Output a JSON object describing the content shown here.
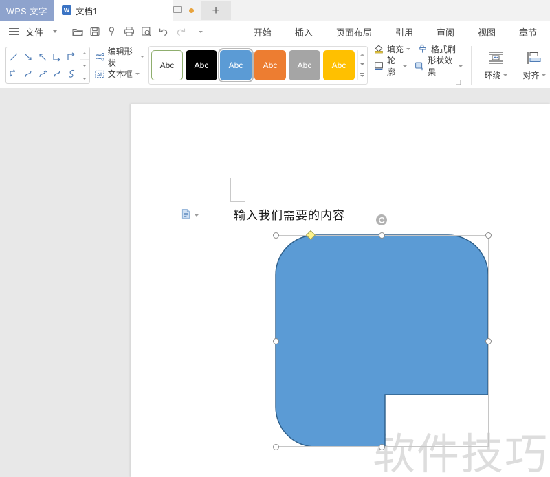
{
  "titlebar": {
    "brand": "WPS 文字",
    "tab": {
      "icon": "wps-writer-icon",
      "badge": "W",
      "title": "文档1"
    },
    "monitor_icon": "monitor-icon",
    "status_dot": "orange-status-dot",
    "new_tab_label": "+"
  },
  "quickaccess": {
    "menu_icon": "hamburger-menu-icon",
    "file_label": "文件",
    "file_chevron": "chevron-down-icon",
    "items": [
      {
        "name": "open-folder-icon",
        "label": "打开"
      },
      {
        "name": "save-icon",
        "label": "保存"
      },
      {
        "name": "touch-mode-icon",
        "label": "触摸"
      },
      {
        "name": "print-icon",
        "label": "打印"
      },
      {
        "name": "print-preview-icon",
        "label": "打印预览"
      },
      {
        "name": "undo-icon",
        "label": "撤销"
      },
      {
        "name": "redo-icon",
        "label": "恢复"
      }
    ],
    "more_chevron": "chevron-down-icon"
  },
  "ribbon_tabs": [
    {
      "label": "开始",
      "active": false
    },
    {
      "label": "插入",
      "active": false
    },
    {
      "label": "页面布局",
      "active": false
    },
    {
      "label": "引用",
      "active": false
    },
    {
      "label": "审阅",
      "active": false
    },
    {
      "label": "视图",
      "active": false
    },
    {
      "label": "章节",
      "active": false
    }
  ],
  "ribbon": {
    "shape_gallery": {
      "shapes": [
        "line-shape",
        "arrow-line-shape",
        "up-arrow-line-shape",
        "elbow-connector-shape",
        "elbow-arrow-connector-shape",
        "elbow-double-arrow-shape",
        "curved-connector-shape",
        "curved-arrow-connector-shape",
        "curved-double-arrow-shape",
        "freeform-curve-shape"
      ],
      "scroll_up": "scroll-up-icon",
      "scroll_down": "scroll-down-icon",
      "more": "gallery-more-icon"
    },
    "edit_shape": {
      "label": "编辑形状",
      "icon": "edit-shape-icon",
      "chevron": "chevron-down-icon"
    },
    "text_box": {
      "label": "文本框",
      "icon": "text-box-icon",
      "chevron": "chevron-down-icon"
    },
    "shape_styles": {
      "label": "Abc",
      "swatches": [
        {
          "name": "style-white-outline",
          "fill": "#ffffff",
          "border": "#8fae6e",
          "text": "#333333",
          "selected": false
        },
        {
          "name": "style-black",
          "fill": "#000000",
          "border": "#000000",
          "text": "#ffffff",
          "selected": false
        },
        {
          "name": "style-blue",
          "fill": "#5b9bd5",
          "border": "#5b9bd5",
          "text": "#ffffff",
          "selected": true
        },
        {
          "name": "style-orange",
          "fill": "#ed7d31",
          "border": "#ed7d31",
          "text": "#ffffff",
          "selected": false
        },
        {
          "name": "style-gray",
          "fill": "#a5a5a5",
          "border": "#a5a5a5",
          "text": "#ffffff",
          "selected": false
        },
        {
          "name": "style-yellow",
          "fill": "#ffc000",
          "border": "#ffc000",
          "text": "#ffffff",
          "selected": false
        }
      ],
      "scroll_up": "scroll-up-icon",
      "scroll_down": "scroll-down-icon",
      "more": "gallery-more-icon"
    },
    "fill": {
      "label": "填充",
      "icon": "fill-bucket-icon",
      "chevron": "chevron-down-icon"
    },
    "format_painter": {
      "label": "格式刷",
      "icon": "format-painter-icon"
    },
    "outline": {
      "label": "轮廓",
      "icon": "shape-outline-icon",
      "chevron": "chevron-down-icon"
    },
    "shape_effects": {
      "label": "形状效果",
      "icon": "shape-effects-icon",
      "chevron": "chevron-down-icon"
    },
    "wrap_text": {
      "label": "环绕",
      "icon": "wrap-text-icon",
      "chevron": "chevron-down-icon"
    },
    "align": {
      "label": "对齐",
      "icon": "align-objects-icon",
      "chevron": "chevron-down-icon"
    },
    "dialog_launcher": "dialog-launcher-icon"
  },
  "document": {
    "paste_options_icon": "paste-options-icon",
    "paste_options_chevron": "chevron-down-icon",
    "body_text": "输入我们需要的内容",
    "watermark": "软件技巧"
  },
  "shape": {
    "name": "rounded-notched-rectangle",
    "fill_color": "#5b9bd5",
    "stroke_color": "#2e5f8a",
    "handles": [
      {
        "name": "handle-top-left",
        "type": "resize"
      },
      {
        "name": "handle-top-center",
        "type": "resize"
      },
      {
        "name": "handle-top-right",
        "type": "resize"
      },
      {
        "name": "handle-middle-left",
        "type": "resize"
      },
      {
        "name": "handle-middle-right",
        "type": "resize"
      },
      {
        "name": "handle-bottom-left",
        "type": "resize"
      },
      {
        "name": "handle-bottom-center",
        "type": "resize"
      },
      {
        "name": "handle-adjust",
        "type": "adjust"
      },
      {
        "name": "handle-rotate",
        "type": "rotate"
      }
    ]
  }
}
